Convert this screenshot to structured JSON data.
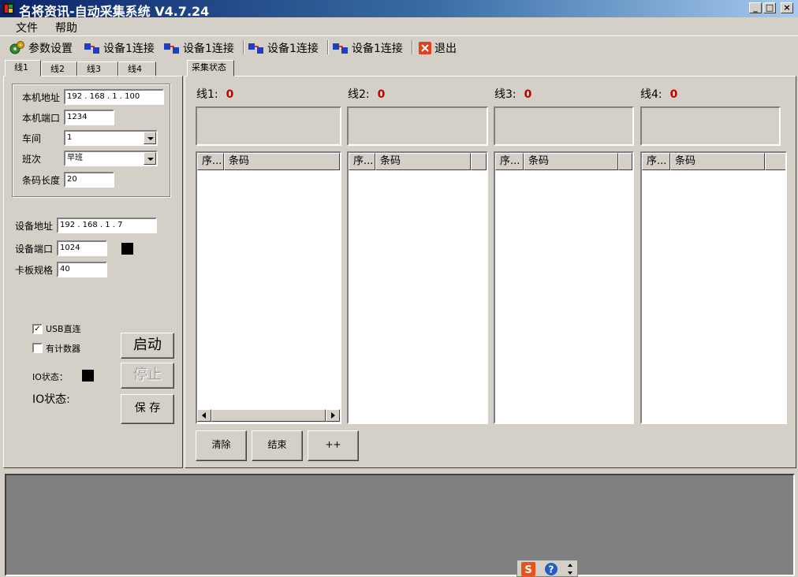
{
  "window": {
    "title": "名将资讯-自动采集系统 V4.7.24",
    "controls": [
      "_",
      "□",
      "×"
    ]
  },
  "menu": [
    "文件",
    "帮助"
  ],
  "toolbar": {
    "settings": "参数设置",
    "conn1": "设备1连接",
    "conn2": "设备1连接",
    "conn3": "设备1连接",
    "conn4": "设备1连接",
    "exit": "退出"
  },
  "left_tabs": [
    "线1",
    "线2",
    "线3",
    "线4"
  ],
  "right_tab": "采集状态",
  "local": {
    "ip_label": "本机地址",
    "ip_value": "192 . 168 . 1 . 100",
    "port_label": "本机端口",
    "port_value": "1234",
    "workshop_label": "车间",
    "workshop_value": "1",
    "shift_label": "班次",
    "shift_value": "早班",
    "barcode_len_label": "条码长度",
    "barcode_len_value": "20"
  },
  "device": {
    "ip_label": "设备地址",
    "ip_value": "192 . 168 . 1 . 7",
    "port_label": "设备端口",
    "port_value": "1024",
    "board_label": "卡板规格",
    "board_value": "40"
  },
  "options": {
    "usb_label": "USB直连",
    "usb_checked": true,
    "counter_label": "有计数器",
    "counter_checked": false
  },
  "io": {
    "status_label1": "IO状态：",
    "status_label2": "IO状态:"
  },
  "buttons": {
    "start": "启动",
    "stop": "停止",
    "save": "保 存",
    "clear": "清除",
    "end": "结束",
    "plus": "++"
  },
  "lines": [
    {
      "label": "线1:",
      "count": "0"
    },
    {
      "label": "线2:",
      "count": "0"
    },
    {
      "label": "线3:",
      "count": "0"
    },
    {
      "label": "线4:",
      "count": "0"
    }
  ],
  "list_columns": [
    "序...",
    "条码"
  ],
  "colors": {
    "title_start": "#0a246a",
    "title_end": "#a6caf0",
    "count_color": "#c00000",
    "log_area": "#808080"
  },
  "icons": {
    "settings": "cog-icon",
    "connect": "network-connect-icon",
    "exit": "exit-icon",
    "app": "app-icon",
    "ime_sogou": "sogou-s-icon",
    "help": "help-icon"
  }
}
